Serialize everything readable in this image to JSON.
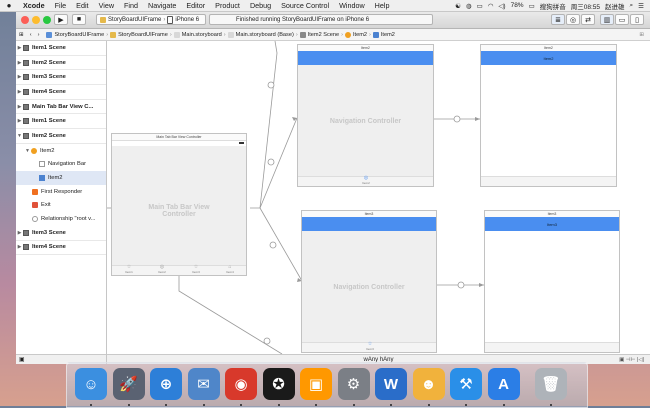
{
  "menubar": {
    "app_name": "Xcode",
    "items": [
      "File",
      "Edit",
      "View",
      "Find",
      "Navigate",
      "Editor",
      "Product",
      "Debug",
      "Source Control",
      "Window",
      "Help"
    ],
    "battery": "78%",
    "input_method": "搜狗拼音",
    "clock": "周三08:55",
    "user": "赵进雄"
  },
  "toolbar": {
    "scheme_target": "StoryBoardUIFrame",
    "scheme_device": "iPhone 6",
    "status_text": "Finished running StoryBoardUIFrame on iPhone 6"
  },
  "jumpbar": {
    "crumbs": [
      "StoryBoardUIFrame",
      "StoryBoardUIFrame",
      "Main.storyboard",
      "Main.storyboard (Base)",
      "Item2 Scene",
      "Item2",
      "Item2"
    ]
  },
  "outline": {
    "rows": [
      {
        "label": "Item1 Scene",
        "kind": "scene"
      },
      {
        "label": "Item2 Scene",
        "kind": "scene"
      },
      {
        "label": "Item3 Scene",
        "kind": "scene"
      },
      {
        "label": "Item4 Scene",
        "kind": "scene"
      },
      {
        "label": "Main Tab Bar View C...",
        "kind": "scene"
      },
      {
        "label": "Item1 Scene",
        "kind": "scene"
      },
      {
        "label": "Item2 Scene",
        "kind": "scene-open"
      },
      {
        "label": "Item2",
        "kind": "controller"
      },
      {
        "label": "Navigation Bar",
        "kind": "navbar"
      },
      {
        "label": "Item2",
        "kind": "tabitem"
      },
      {
        "label": "First Responder",
        "kind": "responder"
      },
      {
        "label": "Exit",
        "kind": "exit"
      },
      {
        "label": "Relationship \"root v...",
        "kind": "relationship"
      },
      {
        "label": "Item3 Scene",
        "kind": "scene"
      },
      {
        "label": "Item4 Scene",
        "kind": "scene"
      }
    ]
  },
  "canvas": {
    "tab_controller": {
      "header": "Main Tab Bar View Controller",
      "body": "Main Tab Bar View Controller",
      "tabs": [
        "Item1",
        "Item2",
        "Item3",
        "Item4"
      ]
    },
    "nav_controller_top": {
      "header": "Item2",
      "body": "Navigation Controller",
      "tab": "Item2"
    },
    "view_top": {
      "header": "Item2",
      "navbar": "Item2"
    },
    "nav_controller_bottom": {
      "header": "Item3",
      "body": "Navigation Controller",
      "tab": "Item3"
    },
    "view_bottom": {
      "header": "Item3",
      "navbar": "Item3"
    }
  },
  "bottombar": {
    "size_class": "wAny hAny"
  },
  "dock": {
    "apps": [
      {
        "name": "finder-icon",
        "color": "#3b8fe0",
        "glyph": "☺"
      },
      {
        "name": "launchpad-icon",
        "color": "#5a6272",
        "glyph": "🚀"
      },
      {
        "name": "safari-icon",
        "color": "#2d7fd8",
        "glyph": "⊕"
      },
      {
        "name": "preview-icon",
        "color": "#4f86c9",
        "glyph": "✉"
      },
      {
        "name": "chrome-icon",
        "color": "#d8392b",
        "glyph": "◉"
      },
      {
        "name": "qq-icon",
        "color": "#1a1a1a",
        "glyph": "✪"
      },
      {
        "name": "sublime-icon",
        "color": "#ff9800",
        "glyph": "▣"
      },
      {
        "name": "system-preferences-icon",
        "color": "#7b7f86",
        "glyph": "⚙"
      },
      {
        "name": "word-icon",
        "color": "#2a6dc9",
        "glyph": "W"
      },
      {
        "name": "qq-game-icon",
        "color": "#f1b23c",
        "glyph": "☻"
      },
      {
        "name": "xcode-icon",
        "color": "#2a8fe8",
        "glyph": "⚒"
      },
      {
        "name": "app-store-icon",
        "color": "#2b7ee6",
        "glyph": "A"
      },
      {
        "name": "trash-icon",
        "color": "#aeb3b9",
        "glyph": "🗑"
      }
    ]
  }
}
